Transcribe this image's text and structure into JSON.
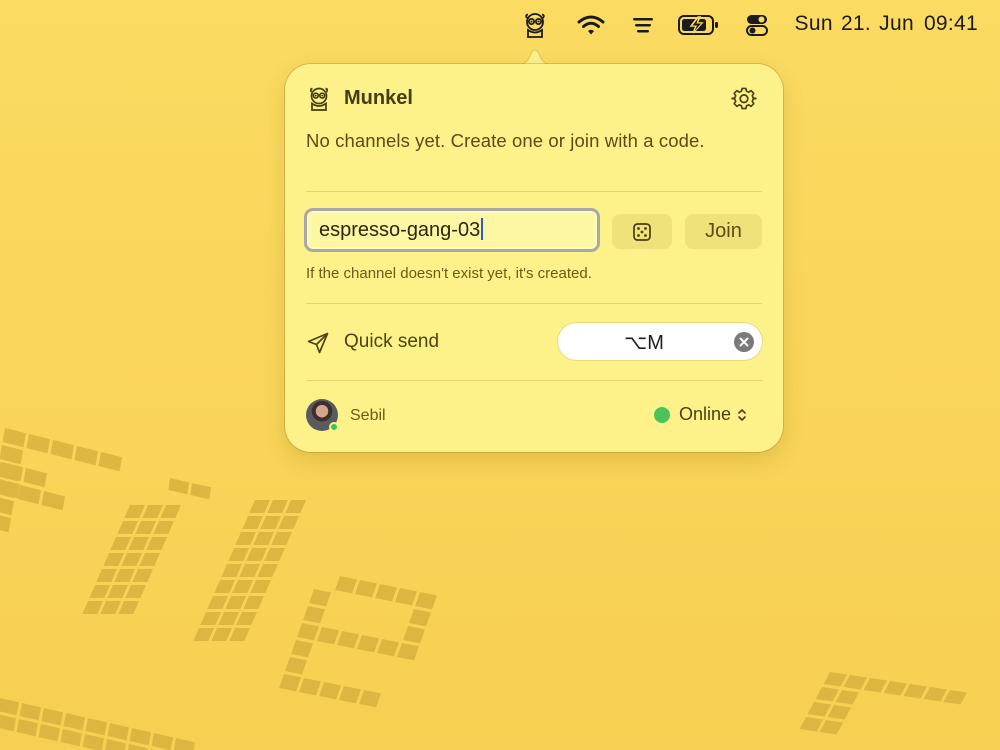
{
  "menubar": {
    "clock_date": "Sun 21. Jun",
    "clock_time": "09:41",
    "icons": [
      "munkel-app-icon",
      "wifi-icon",
      "focus-lines-icon",
      "battery-charging-icon",
      "control-center-icon"
    ]
  },
  "popover": {
    "app_name": "Munkel",
    "empty_message": "No channels yet. Create one or join with a code.",
    "channel_input": {
      "value": "espresso-gang-03"
    },
    "join_label": "Join",
    "hint": "If the channel doesn't exist yet, it's created.",
    "quick_send": {
      "label": "Quick send",
      "shortcut": "⌥M"
    },
    "user": {
      "name": "Sebil"
    },
    "status": {
      "label": "Online",
      "color": "#4cc25a"
    }
  },
  "colors": {
    "background": "#fbdb62",
    "popover": "#fdf28a",
    "button": "#f0e27a"
  }
}
